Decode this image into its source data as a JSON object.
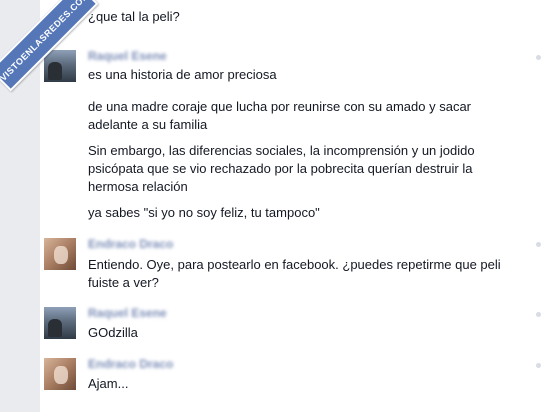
{
  "watermark": {
    "text": "VISTOENLASREDES.COM"
  },
  "conversation": {
    "first_message": "¿que tal la peli?",
    "blocks": [
      {
        "sender": "Raquel Esene",
        "avatar": "raquel",
        "messages": [
          "es una historia de amor preciosa",
          "de una madre coraje que lucha por reunirse con su amado y sacar adelante a su familia",
          "Sin embargo, las diferencias sociales, la incomprensión y un jodido psicópata que se vio rechazado por la pobrecita querían destruir la hermosa relación",
          "ya sabes \"si yo no soy feliz, tu tampoco\""
        ]
      },
      {
        "sender": "Endraco Draco",
        "avatar": "endraco",
        "messages": [
          "Entiendo. Oye, para postearlo en facebook. ¿puedes repetirme que peli fuiste a ver?"
        ]
      },
      {
        "sender": "Raquel Esene",
        "avatar": "raquel",
        "messages": [
          "GOdzilla"
        ]
      },
      {
        "sender": "Endraco Draco",
        "avatar": "endraco",
        "messages": [
          "Ajam..."
        ]
      }
    ]
  }
}
